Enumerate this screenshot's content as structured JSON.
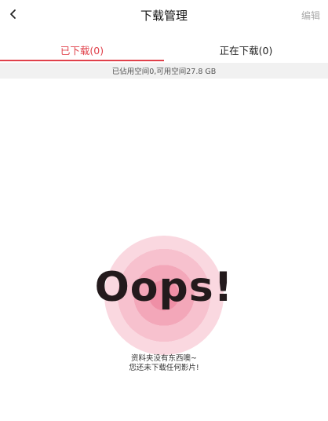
{
  "header": {
    "title": "下载管理",
    "edit_label": "编辑",
    "back_icon": "chevron-left-icon"
  },
  "tabs": [
    {
      "label": "已下载(0)",
      "active": true
    },
    {
      "label": "正在下载(0)",
      "active": false
    }
  ],
  "storage": {
    "text": "已佔用空间0,可用空间27.8 GB"
  },
  "empty_state": {
    "headline": "Oops!",
    "line1": "资料夹没有东西噢~",
    "line2": "您还未下载任何影片!"
  },
  "colors": {
    "accent": "#e0404a",
    "ripple_inner": "#ef8fa6",
    "ripple_outer": "#fdebef",
    "storage_bg": "#f1f1f1"
  }
}
